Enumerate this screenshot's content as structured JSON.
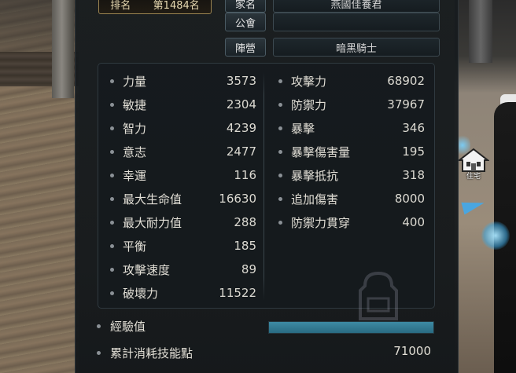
{
  "header": {
    "rank_label": "排名",
    "rank_value": "第1484名",
    "rows": [
      {
        "label": "家名",
        "value": "燕國佳養君"
      },
      {
        "label": "公會",
        "value": ""
      },
      {
        "label": "陣營",
        "value": "暗黑騎士"
      }
    ]
  },
  "stats": {
    "left": [
      {
        "label": "力量",
        "value": "3573"
      },
      {
        "label": "敏捷",
        "value": "2304"
      },
      {
        "label": "智力",
        "value": "4239"
      },
      {
        "label": "意志",
        "value": "2477"
      },
      {
        "label": "幸運",
        "value": "116"
      },
      {
        "label": "最大生命值",
        "value": "16630"
      },
      {
        "label": "最大耐力值",
        "value": "288"
      },
      {
        "label": "平衡",
        "value": "185"
      },
      {
        "label": "攻擊速度",
        "value": "89"
      },
      {
        "label": "破壞力",
        "value": "11522"
      }
    ],
    "right": [
      {
        "label": "攻擊力",
        "value": "68902"
      },
      {
        "label": "防禦力",
        "value": "37967"
      },
      {
        "label": "暴擊",
        "value": "346"
      },
      {
        "label": "暴擊傷害量",
        "value": "195"
      },
      {
        "label": "暴擊抵抗",
        "value": "318"
      },
      {
        "label": "追加傷害",
        "value": "8000"
      },
      {
        "label": "防禦力貫穿",
        "value": "400"
      }
    ]
  },
  "footer": {
    "exp_label": "經驗值",
    "exp_fill": 1.0,
    "skill_points_label": "累計消耗技能點",
    "skill_points_value": "71000"
  },
  "scene": {
    "house_label": "住宅"
  },
  "colors": {
    "panel_bg": "#161c20",
    "exp_bar": "#3d8aa3",
    "rank_border": "#9a8350"
  }
}
